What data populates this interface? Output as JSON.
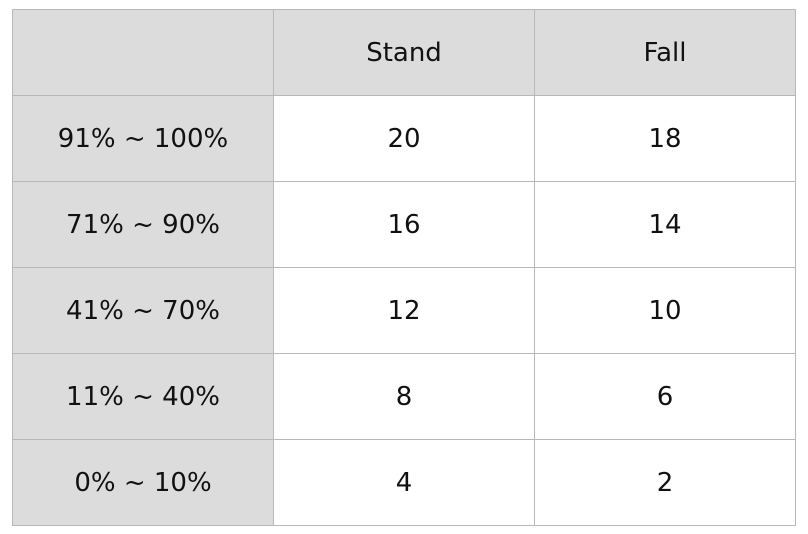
{
  "table": {
    "header": {
      "corner": "",
      "columns": [
        "Stand",
        "Fall"
      ]
    },
    "rows": [
      {
        "label": "91% ~ 100%",
        "stand": "20",
        "fall": "18"
      },
      {
        "label": "71% ~ 90%",
        "stand": "16",
        "fall": "14"
      },
      {
        "label": "41% ~ 70%",
        "stand": "12",
        "fall": "10"
      },
      {
        "label": "11% ~ 40%",
        "stand": "8",
        "fall": "6"
      },
      {
        "label": "0% ~ 10%",
        "stand": "4",
        "fall": "2"
      }
    ]
  },
  "colors": {
    "header_bg": "#dcdcdc",
    "row_label_bg": "#dcdcdc",
    "cell_bg": "#ffffff",
    "border": "#b8b8b8",
    "text": "#111111"
  }
}
